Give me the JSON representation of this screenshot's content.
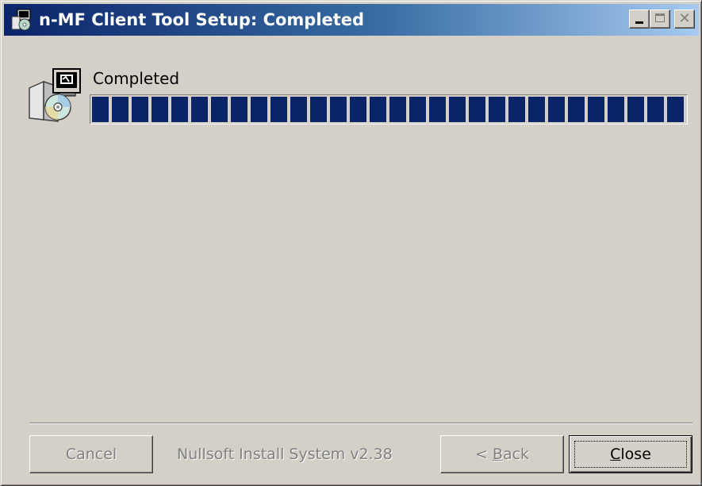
{
  "window": {
    "title": "n-MF Client Tool Setup: Completed"
  },
  "icons": {
    "title_icon": "installer-icon",
    "main_icon": "setup-cd-icon"
  },
  "status": {
    "text": "Completed",
    "progress_percent": 100
  },
  "footer": {
    "branding": "Nullsoft Install System v2.38"
  },
  "buttons": {
    "cancel": "Cancel",
    "back_prefix": "< ",
    "back_accel": "B",
    "back_rest": "ack",
    "close_accel": "C",
    "close_rest": "lose"
  },
  "colors": {
    "titlebar_start": "#0a246a",
    "titlebar_end": "#a6caf0",
    "progress_fill": "#0a246a",
    "dialog_bg": "#d4d0c8"
  }
}
